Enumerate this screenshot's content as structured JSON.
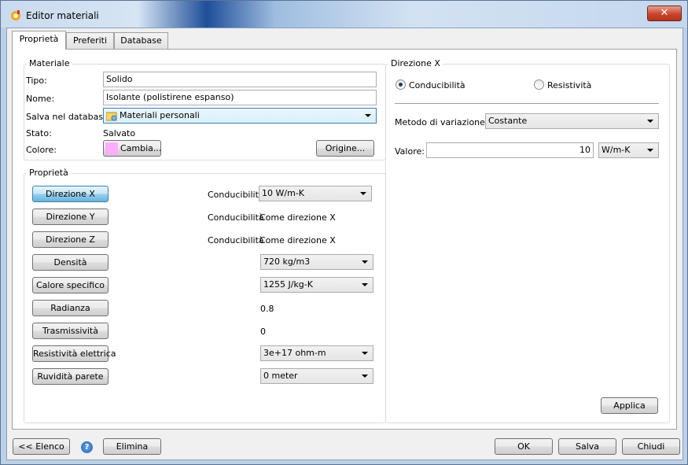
{
  "window": {
    "title": "Editor materiali",
    "close_glyph": "✕"
  },
  "tabs": [
    {
      "label": "Proprietà"
    },
    {
      "label": "Preferiti"
    },
    {
      "label": "Database"
    }
  ],
  "materiale": {
    "group_label": "Materiale",
    "tipo_label": "Tipo:",
    "tipo_value": "Solido",
    "nome_label": "Nome:",
    "nome_value": "Isolante (polistirene espanso)",
    "salva_label": "Salva nel database:",
    "salva_value": "Materiali personali",
    "stato_label": "Stato:",
    "stato_value": "Salvato",
    "colore_label": "Colore:",
    "colore_button": "Cambia...",
    "origine_button": "Origine...",
    "swatch_color": "#ffadff"
  },
  "proprieta": {
    "group_label": "Proprietà",
    "rows": [
      {
        "button": "Direzione X",
        "label": "Conducibilità",
        "value": "10 W/m-K",
        "combo": true
      },
      {
        "button": "Direzione Y",
        "label": "Conducibilità",
        "value": "Come direzione X",
        "combo": false
      },
      {
        "button": "Direzione Z",
        "label": "Conducibilità",
        "value": "Come direzione X",
        "combo": false
      },
      {
        "button": "Densità",
        "label": "",
        "value": "720 kg/m3",
        "combo": true
      },
      {
        "button": "Calore specifico",
        "label": "",
        "value": "1255 J/kg-K",
        "combo": true
      },
      {
        "button": "Radianza",
        "label": "",
        "value": "0.8",
        "combo": false
      },
      {
        "button": "Trasmissività",
        "label": "",
        "value": "0",
        "combo": false
      },
      {
        "button": "Resistività elettrica",
        "label": "",
        "value": "3e+17 ohm-m",
        "combo": true
      },
      {
        "button": "Ruvidità parete",
        "label": "",
        "value": "0 meter",
        "combo": true
      }
    ]
  },
  "direzione": {
    "group_label": "Direzione X",
    "radio_conducibilita": "Conducibilità",
    "radio_resistivita": "Resistività",
    "metodo_label": "Metodo di variazione:",
    "metodo_value": "Costante",
    "valore_label": "Valore:",
    "valore_value": "10",
    "valore_unit": "W/m-K",
    "applica_button": "Applica"
  },
  "footer": {
    "elenco_button": "<< Elenco",
    "help_glyph": "?",
    "elimina_button": "Elimina",
    "ok_button": "OK",
    "salva_button": "Salva",
    "chiudi_button": "Chiudi"
  }
}
